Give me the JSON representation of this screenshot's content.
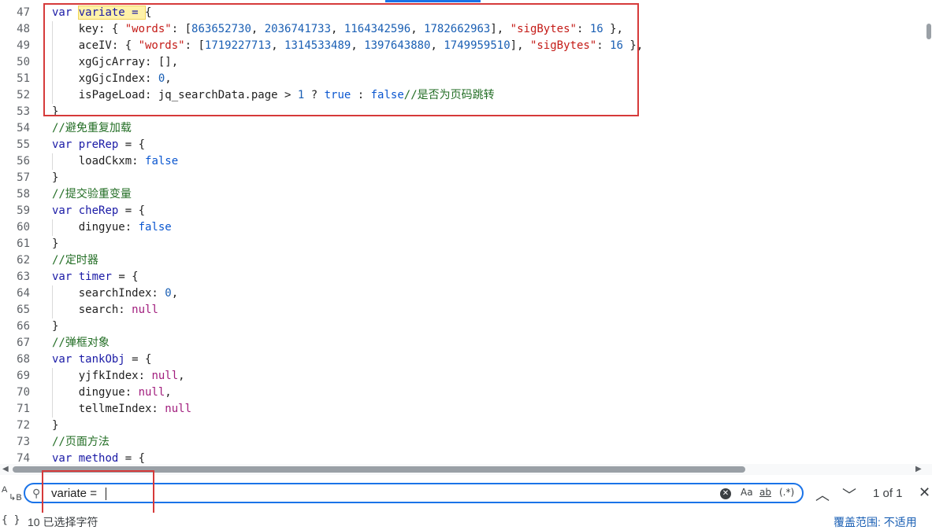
{
  "editor": {
    "lines": [
      {
        "n": "47",
        "indent": false,
        "tokens": [
          [
            "kw",
            "var"
          ],
          [
            "ident",
            " "
          ],
          [
            "def hl",
            "variate = "
          ],
          [
            "ident",
            "{"
          ]
        ]
      },
      {
        "n": "48",
        "indent": true,
        "tokens": [
          [
            "ident",
            "    key: { "
          ],
          [
            "str",
            "\"words\""
          ],
          [
            "ident",
            ": ["
          ],
          [
            "num",
            "863652730"
          ],
          [
            "ident",
            ", "
          ],
          [
            "num",
            "2036741733"
          ],
          [
            "ident",
            ", "
          ],
          [
            "num",
            "1164342596"
          ],
          [
            "ident",
            ", "
          ],
          [
            "num",
            "1782662963"
          ],
          [
            "ident",
            "], "
          ],
          [
            "str",
            "\"sigBytes\""
          ],
          [
            "ident",
            ": "
          ],
          [
            "num",
            "16"
          ],
          [
            "ident",
            " },"
          ]
        ]
      },
      {
        "n": "49",
        "indent": true,
        "tokens": [
          [
            "ident",
            "    aceIV: { "
          ],
          [
            "str",
            "\"words\""
          ],
          [
            "ident",
            ": ["
          ],
          [
            "num",
            "1719227713"
          ],
          [
            "ident",
            ", "
          ],
          [
            "num",
            "1314533489"
          ],
          [
            "ident",
            ", "
          ],
          [
            "num",
            "1397643880"
          ],
          [
            "ident",
            ", "
          ],
          [
            "num",
            "1749959510"
          ],
          [
            "ident",
            "], "
          ],
          [
            "str",
            "\"sigBytes\""
          ],
          [
            "ident",
            ": "
          ],
          [
            "num",
            "16"
          ],
          [
            "ident",
            " },"
          ]
        ]
      },
      {
        "n": "50",
        "indent": true,
        "tokens": [
          [
            "ident",
            "    xgGjcArray: [],"
          ]
        ]
      },
      {
        "n": "51",
        "indent": true,
        "tokens": [
          [
            "ident",
            "    xgGjcIndex: "
          ],
          [
            "num",
            "0"
          ],
          [
            "ident",
            ","
          ]
        ]
      },
      {
        "n": "52",
        "indent": true,
        "tokens": [
          [
            "ident",
            "    isPageLoad: jq_searchData.page > "
          ],
          [
            "num",
            "1"
          ],
          [
            "ident",
            " ? "
          ],
          [
            "kw2",
            "true"
          ],
          [
            "ident",
            " : "
          ],
          [
            "kw2",
            "false"
          ],
          [
            "cmt",
            "//是否为页码跳转"
          ]
        ]
      },
      {
        "n": "53",
        "indent": false,
        "tokens": [
          [
            "ident",
            "}"
          ]
        ]
      },
      {
        "n": "54",
        "indent": false,
        "tokens": [
          [
            "cmt",
            "//避免重复加载"
          ]
        ]
      },
      {
        "n": "55",
        "indent": false,
        "tokens": [
          [
            "kw",
            "var"
          ],
          [
            "ident",
            " "
          ],
          [
            "def",
            "preRep"
          ],
          [
            "ident",
            " = {"
          ]
        ]
      },
      {
        "n": "56",
        "indent": true,
        "tokens": [
          [
            "ident",
            "    loadCkxm: "
          ],
          [
            "kw2",
            "false"
          ]
        ]
      },
      {
        "n": "57",
        "indent": false,
        "tokens": [
          [
            "ident",
            "}"
          ]
        ]
      },
      {
        "n": "58",
        "indent": false,
        "tokens": [
          [
            "cmt",
            "//提交验重变量"
          ]
        ]
      },
      {
        "n": "59",
        "indent": false,
        "tokens": [
          [
            "kw",
            "var"
          ],
          [
            "ident",
            " "
          ],
          [
            "def",
            "cheRep"
          ],
          [
            "ident",
            " = {"
          ]
        ]
      },
      {
        "n": "60",
        "indent": true,
        "tokens": [
          [
            "ident",
            "    dingyue: "
          ],
          [
            "kw2",
            "false"
          ]
        ]
      },
      {
        "n": "61",
        "indent": false,
        "tokens": [
          [
            "ident",
            "}"
          ]
        ]
      },
      {
        "n": "62",
        "indent": false,
        "tokens": [
          [
            "cmt",
            "//定时器"
          ]
        ]
      },
      {
        "n": "63",
        "indent": false,
        "tokens": [
          [
            "kw",
            "var"
          ],
          [
            "ident",
            " "
          ],
          [
            "def",
            "timer"
          ],
          [
            "ident",
            " = {"
          ]
        ]
      },
      {
        "n": "64",
        "indent": true,
        "tokens": [
          [
            "ident",
            "    searchIndex: "
          ],
          [
            "num",
            "0"
          ],
          [
            "ident",
            ","
          ]
        ]
      },
      {
        "n": "65",
        "indent": true,
        "tokens": [
          [
            "ident",
            "    search: "
          ],
          [
            "lit",
            "null"
          ]
        ]
      },
      {
        "n": "66",
        "indent": false,
        "tokens": [
          [
            "ident",
            "}"
          ]
        ]
      },
      {
        "n": "67",
        "indent": false,
        "tokens": [
          [
            "cmt",
            "//弹框对象"
          ]
        ]
      },
      {
        "n": "68",
        "indent": false,
        "tokens": [
          [
            "kw",
            "var"
          ],
          [
            "ident",
            " "
          ],
          [
            "def",
            "tankObj"
          ],
          [
            "ident",
            " = {"
          ]
        ]
      },
      {
        "n": "69",
        "indent": true,
        "tokens": [
          [
            "ident",
            "    yjfkIndex: "
          ],
          [
            "lit",
            "null"
          ],
          [
            "ident",
            ","
          ]
        ]
      },
      {
        "n": "70",
        "indent": true,
        "tokens": [
          [
            "ident",
            "    dingyue: "
          ],
          [
            "lit",
            "null"
          ],
          [
            "ident",
            ","
          ]
        ]
      },
      {
        "n": "71",
        "indent": true,
        "tokens": [
          [
            "ident",
            "    tellmeIndex: "
          ],
          [
            "lit",
            "null"
          ]
        ]
      },
      {
        "n": "72",
        "indent": false,
        "tokens": [
          [
            "ident",
            "}"
          ]
        ]
      },
      {
        "n": "73",
        "indent": false,
        "tokens": [
          [
            "cmt",
            "//页面方法"
          ]
        ]
      },
      {
        "n": "74",
        "indent": false,
        "tokens": [
          [
            "kw",
            "var"
          ],
          [
            "ident",
            " "
          ],
          [
            "def",
            "method"
          ],
          [
            "ident",
            " = {"
          ]
        ]
      }
    ]
  },
  "find": {
    "query": "variate = ",
    "match_case_label": "Aa",
    "whole_word_label": "ab",
    "regex_label": "(.*)",
    "prev_icon": "chevron-up-icon",
    "next_icon": "chevron-down-icon",
    "count": "1 of 1",
    "close_icon": "close-icon"
  },
  "status": {
    "braces": "{ }",
    "selected": "10 已选择字符",
    "coverage": "覆盖范围: 不适用"
  }
}
